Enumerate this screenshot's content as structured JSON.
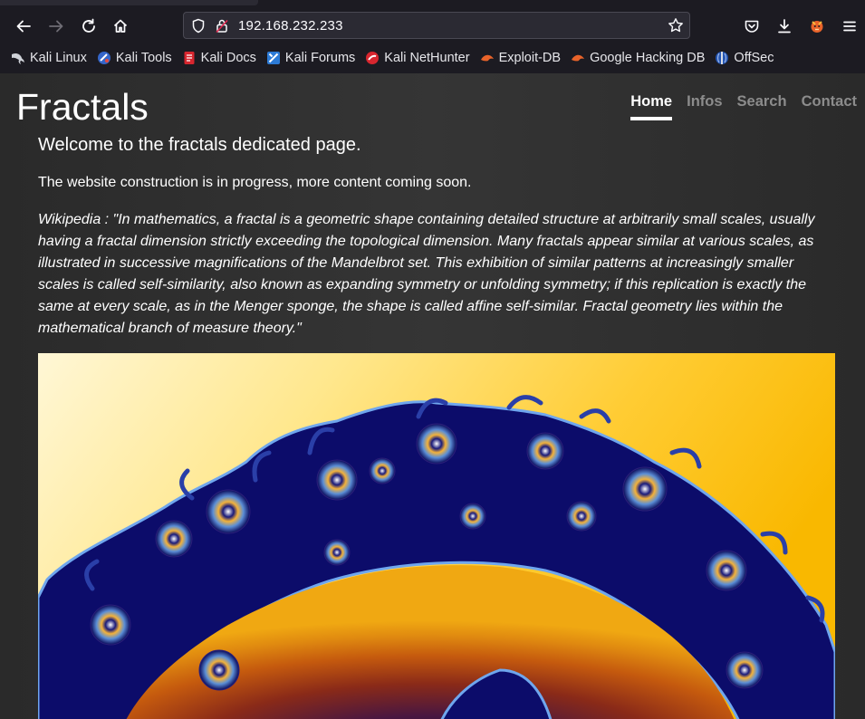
{
  "browser": {
    "url": "192.168.232.233",
    "bookmarks": [
      {
        "label": "Kali Linux",
        "icon": "kali-dragon-icon"
      },
      {
        "label": "Kali Tools",
        "icon": "kali-tools-icon"
      },
      {
        "label": "Kali Docs",
        "icon": "kali-docs-icon"
      },
      {
        "label": "Kali Forums",
        "icon": "kali-forums-icon"
      },
      {
        "label": "Kali NetHunter",
        "icon": "kali-nethunter-icon"
      },
      {
        "label": "Exploit-DB",
        "icon": "exploit-db-icon"
      },
      {
        "label": "Google Hacking DB",
        "icon": "ghdb-icon"
      },
      {
        "label": "OffSec",
        "icon": "offsec-icon"
      }
    ]
  },
  "site": {
    "title": "Fractals",
    "nav": [
      {
        "label": "Home",
        "active": true
      },
      {
        "label": "Infos",
        "active": false
      },
      {
        "label": "Search",
        "active": false
      },
      {
        "label": "Contact",
        "active": false
      }
    ],
    "lead": "Welcome to the fractals dedicated page.",
    "paragraph": "The website construction is in progress, more content coming soon.",
    "quote": "Wikipedia : \"In mathematics, a fractal is a geometric shape containing detailed structure at arbitrarily small scales, usually having a fractal dimension strictly exceeding the topological dimension. Many fractals appear similar at various scales, as illustrated in successive magnifications of the Mandelbrot set. This exhibition of similar patterns at increasingly smaller scales is called self-similarity, also known as expanding symmetry or unfolding symmetry; if this replication is exactly the same at every scale, as in the Menger sponge, the shape is called affine self-similar. Fractal geometry lies within the mathematical branch of measure theory.\""
  }
}
